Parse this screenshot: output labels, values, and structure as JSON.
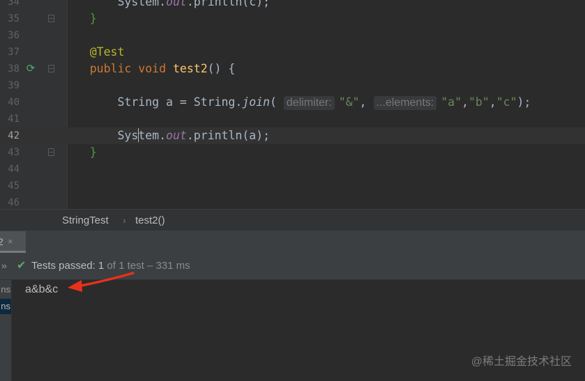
{
  "editor": {
    "lines": [
      {
        "num": "34",
        "parts": [
          {
            "t": "        System.",
            "c": ""
          },
          {
            "t": "out",
            "c": "field"
          },
          {
            "t": ".println(c);",
            "c": ""
          }
        ]
      },
      {
        "num": "35",
        "parts": [
          {
            "t": "    }",
            "c": "br"
          }
        ]
      },
      {
        "num": "36",
        "parts": []
      },
      {
        "num": "37",
        "parts": [
          {
            "t": "    @Test",
            "c": "an"
          }
        ]
      },
      {
        "num": "38",
        "parts": [
          {
            "t": "    public void ",
            "c": "kw"
          },
          {
            "t": "test2",
            "c": "fn"
          },
          {
            "t": "() {",
            "c": ""
          }
        ]
      },
      {
        "num": "39",
        "parts": []
      },
      {
        "num": "40",
        "parts": [
          {
            "t": "        String a = String.",
            "c": ""
          },
          {
            "t": "join",
            "c": "it"
          },
          {
            "t": "( ",
            "c": ""
          },
          {
            "t": "delimiter:",
            "c": "hint"
          },
          {
            "t": "\"&\"",
            "c": "st"
          },
          {
            "t": ", ",
            "c": ""
          },
          {
            "t": "...elements:",
            "c": "hint"
          },
          {
            "t": "\"a\"",
            "c": "st"
          },
          {
            "t": ",",
            "c": ""
          },
          {
            "t": "\"b\"",
            "c": "st"
          },
          {
            "t": ",",
            "c": ""
          },
          {
            "t": "\"c\"",
            "c": "st"
          },
          {
            "t": ");",
            "c": ""
          }
        ]
      },
      {
        "num": "41",
        "parts": []
      },
      {
        "num": "42",
        "parts": [
          {
            "t": "        Sys",
            "c": ""
          },
          {
            "t": "",
            "c": "caret"
          },
          {
            "t": "tem.",
            "c": ""
          },
          {
            "t": "out",
            "c": "field"
          },
          {
            "t": ".println(a);",
            "c": ""
          }
        ]
      },
      {
        "num": "43",
        "parts": [
          {
            "t": "    }",
            "c": "br"
          }
        ]
      },
      {
        "num": "44",
        "parts": []
      },
      {
        "num": "45",
        "parts": []
      },
      {
        "num": "46",
        "parts": []
      }
    ],
    "current_line": "42",
    "run_icon": "run-test-gutter-icon"
  },
  "breadcrumb": {
    "items": [
      "StringTest",
      "test2()"
    ],
    "separator": "›"
  },
  "run_panel": {
    "tab_label": "2",
    "close_icon": "×",
    "status": {
      "prefix": "Tests passed: ",
      "count": "1",
      "suffix": " of 1 test – 331 ms"
    },
    "sidebar_items": [
      "ns",
      "ns"
    ],
    "console_lines": [
      "a&b&c"
    ]
  },
  "watermark": "@稀土掘金技术社区",
  "colors": {
    "arrow": "#e8301c",
    "passed": "#59a869"
  }
}
